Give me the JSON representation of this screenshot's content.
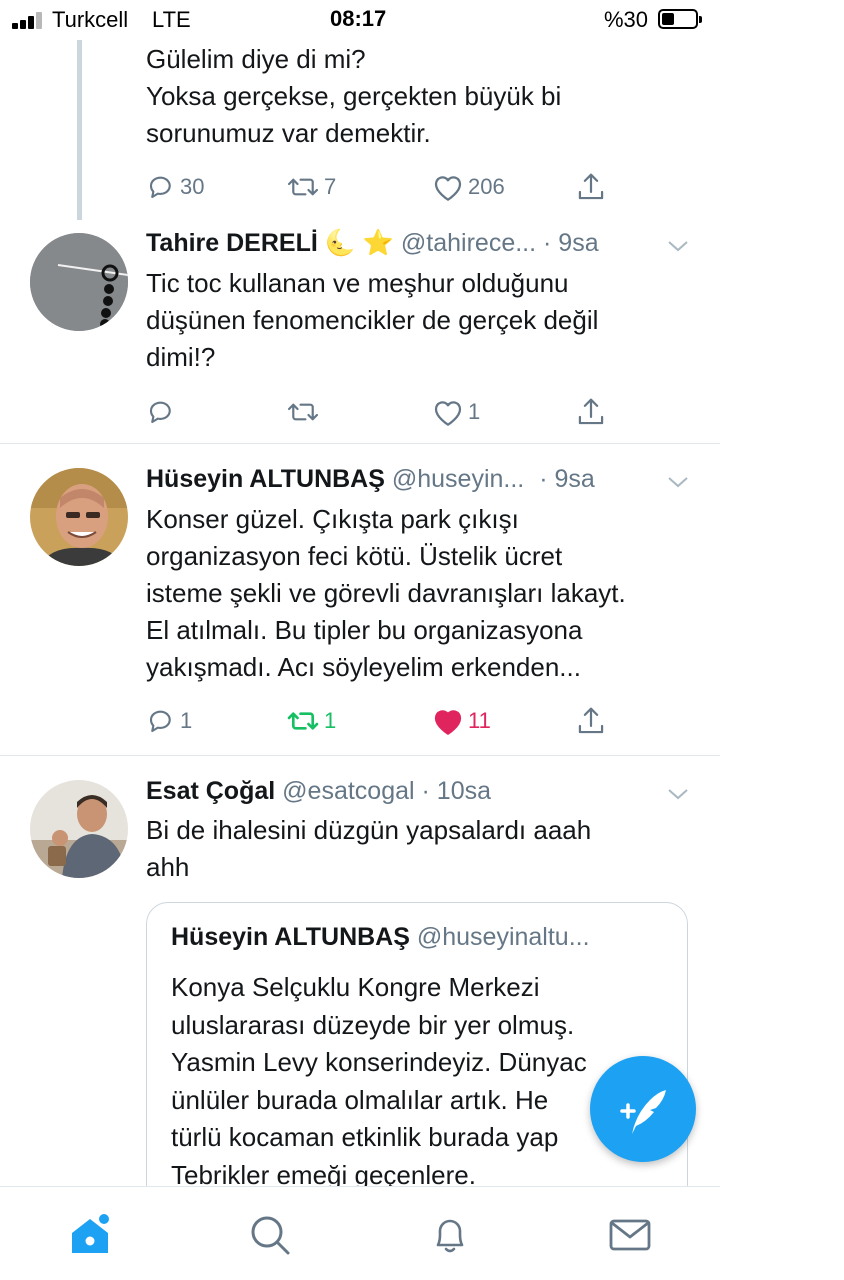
{
  "status_bar": {
    "carrier": "Turkcell",
    "network": "LTE",
    "time": "08:17",
    "battery_text": "%30",
    "battery_level": 0.3
  },
  "colors": {
    "accent": "#1da1f2",
    "muted": "#657786",
    "like_active": "#e0245e",
    "retweet_active": "#17bf63"
  },
  "tweets": [
    {
      "text_lines": [
        "Gülelim diye di mi?",
        "Yoksa gerçekse, gerçekten büyük bi",
        "sorunumuz var demektir."
      ],
      "replies": "30",
      "retweets": "7",
      "likes": "206"
    },
    {
      "name": "Tahire DERELİ",
      "name_emoji": "🌜 ⭐",
      "handle": "@tahirece...",
      "time": "· 9sa",
      "text_lines": [
        "Tic toc kullanan ve meşhur olduğunu",
        "düşünen fenomencikler de gerçek değil",
        "dimi!?"
      ],
      "replies": "",
      "retweets": "",
      "likes": "1"
    },
    {
      "name": "Hüseyin ALTUNBAŞ",
      "handle": "@huseyin...",
      "time": "· 9sa",
      "text_lines": [
        "Konser güzel. Çıkışta park çıkışı",
        "organizasyon feci kötü. Üstelik ücret",
        "isteme şekli ve görevli davranışları lakayt.",
        "El atılmalı. Bu tipler bu organizasyona",
        "yakışmadı. Acı söyleyelim erkenden..."
      ],
      "replies": "1",
      "retweets": "1",
      "likes": "11",
      "retweeted": true,
      "liked": true
    },
    {
      "name": "Esat Çoğal",
      "handle": "@esatcogal",
      "time": "· 10sa",
      "text_lines": [
        "Bi de ihalesini düzgün yapsalardı aaah",
        "ahh"
      ],
      "quote": {
        "name": "Hüseyin ALTUNBAŞ",
        "handle": "@huseyinaltu...",
        "text_lines": [
          "Konya Selçuklu Kongre Merkezi",
          "uluslararası düzeyde bir yer olmuş.",
          "Yasmin Levy konserindeyiz. Dünyac",
          "ünlüler burada olmalılar artık. He",
          "türlü kocaman etkinlik burada yap",
          "Tebrikler emeği geçenlere."
        ]
      }
    }
  ],
  "icons": {
    "reply": "reply-icon",
    "retweet": "retweet-icon",
    "like": "heart-icon",
    "share": "share-icon",
    "caret": "chevron-down-icon",
    "compose": "compose-tweet-icon",
    "home": "home-icon",
    "search": "search-icon",
    "notifications": "bell-icon",
    "messages": "mail-icon"
  }
}
